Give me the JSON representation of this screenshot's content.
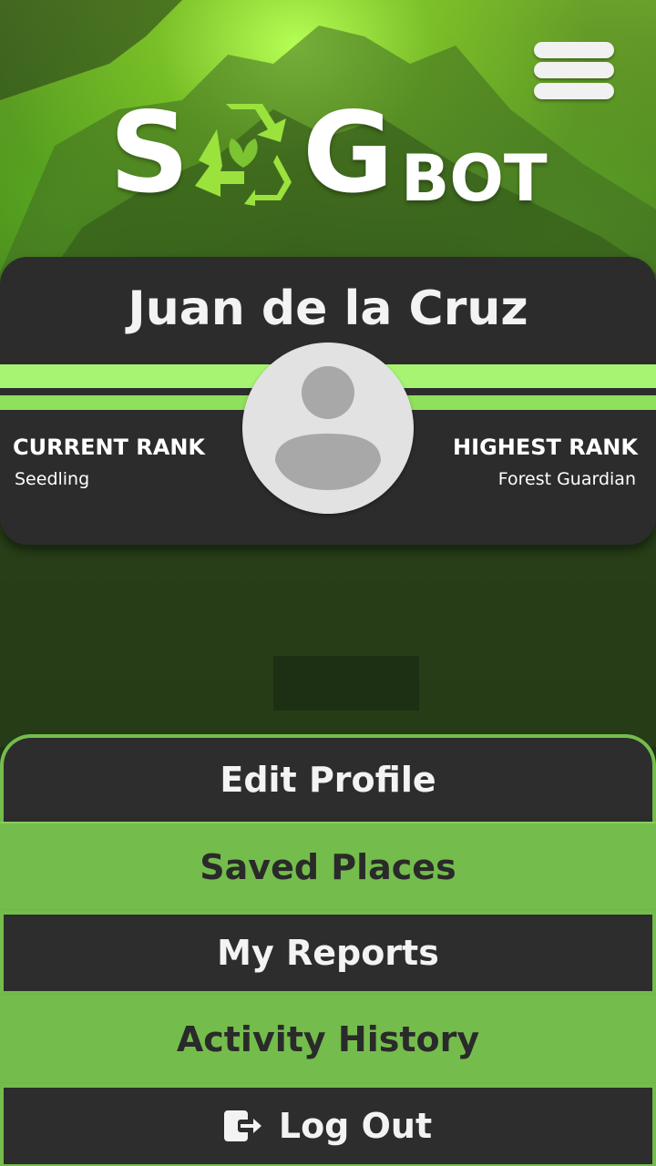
{
  "app": {
    "logo_letter_s": "S",
    "logo_letter_g": "G",
    "logo_suffix": "BOT",
    "menu_icon": "hamburger-menu-icon",
    "logo_icon": "recycle-leaf-icon"
  },
  "profile": {
    "name": "Juan de la Cruz",
    "avatar_icon": "default-user-avatar-icon",
    "current_rank_label": "CURRENT RANK",
    "current_rank_value": "Seedling",
    "highest_rank_label": "HIGHEST RANK",
    "highest_rank_value": "Forest Guardian"
  },
  "actions": {
    "edit_profile": "Edit Profile",
    "saved_places": "Saved Places",
    "my_reports": "My Reports",
    "activity_history": "Activity History",
    "log_out": "Log Out",
    "log_out_icon": "logout-arrow-icon"
  },
  "colors": {
    "accent_green": "#74bd4c",
    "stripe_light_green": "#a6f472",
    "logo_green": "#9be23d",
    "card_dark": "#2c2c2c",
    "text_light": "#f3f3f3",
    "text_dark": "#2a2a2a"
  }
}
